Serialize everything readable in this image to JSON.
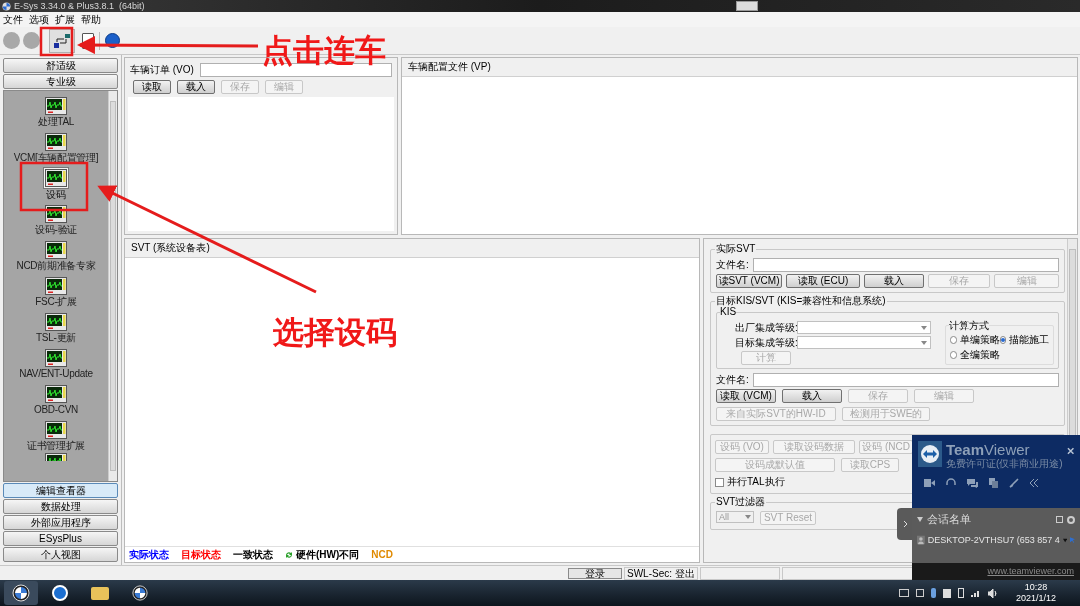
{
  "window": {
    "title": "E-Sys 3.34.0 & Plus3.8.1  (64bit)"
  },
  "menu": [
    "文件",
    "选项",
    "扩展",
    "帮助"
  ],
  "annotations": [
    {
      "text": "点击连车"
    },
    {
      "text": "选择设码"
    }
  ],
  "sidebar": {
    "top_buttons": [
      "舒适级",
      "专业级"
    ],
    "items": [
      {
        "label": "处理TAL",
        "selected": false
      },
      {
        "label": "VCM[车辆配置管理]",
        "selected": false
      },
      {
        "label": "设码",
        "selected": true
      },
      {
        "label": "设码-验证",
        "selected": false
      },
      {
        "label": "NCD前期准备专家",
        "selected": false
      },
      {
        "label": "FSC-扩展",
        "selected": false
      },
      {
        "label": "TSL-更新",
        "selected": false
      },
      {
        "label": "NAV/ENT-Update",
        "selected": false
      },
      {
        "label": "OBD-CVN",
        "selected": false
      },
      {
        "label": "证书管理扩展",
        "selected": false
      }
    ],
    "bottom_buttons": [
      {
        "label": "编辑查看器",
        "selected": true
      },
      {
        "label": "数据处理",
        "selected": false
      },
      {
        "label": "外部应用程序",
        "selected": false
      },
      {
        "label": "ESysPlus",
        "selected": false
      },
      {
        "label": "个人视图",
        "selected": false
      }
    ]
  },
  "vehicle_order": {
    "label": "车辆订单 (VO)",
    "buttons": [
      {
        "label": "读取",
        "disabled": false
      },
      {
        "label": "载入",
        "disabled": false
      },
      {
        "label": "保存",
        "disabled": true
      },
      {
        "label": "编辑",
        "disabled": true
      }
    ]
  },
  "vehicle_profile": {
    "title": "车辆配置文件 (VP)"
  },
  "svt": {
    "title": "SVT (系统设备表)",
    "legend": [
      {
        "kind": "text",
        "label": "实际状态",
        "color": "#0000ff"
      },
      {
        "kind": "text",
        "label": "目标状态",
        "color": "#ff0000"
      },
      {
        "kind": "text",
        "label": "一致状态",
        "color": "#000000"
      },
      {
        "kind": "icon",
        "label": "硬件(HW)不同",
        "color": "#000000"
      },
      {
        "kind": "text",
        "label": "NCD",
        "color": "#e08a00"
      }
    ]
  },
  "actual_svt": {
    "title": "实际SVT",
    "file_label": "文件名:",
    "buttons": [
      {
        "label": "读SVT (VCM)",
        "disabled": false
      },
      {
        "label": "读取 (ECU)",
        "disabled": false
      },
      {
        "label": "载入",
        "disabled": false
      },
      {
        "label": "保存",
        "disabled": true
      },
      {
        "label": "编辑",
        "disabled": true
      }
    ]
  },
  "target": {
    "title": "目标KIS/SVT (KIS=兼容性和信息系统)",
    "kis_title": "KIS",
    "fields": [
      "出厂集成等级:",
      "目标集成等级:"
    ],
    "calc_button": {
      "label": "计算",
      "disabled": true
    },
    "method": {
      "title": "计算方式",
      "options": [
        {
          "label": "单编策略",
          "selected": false
        },
        {
          "label": "描能施工",
          "selected": true
        },
        {
          "label": "全编策略",
          "selected": false
        }
      ]
    },
    "file_label": "文件名:",
    "buttons": [
      {
        "label": "读取 (VCM)",
        "disabled": false
      },
      {
        "label": "载入",
        "disabled": false
      },
      {
        "label": "保存",
        "disabled": true
      },
      {
        "label": "编辑",
        "disabled": true
      }
    ],
    "buttons_2": [
      {
        "label": "来自实际SVT的HW-ID",
        "disabled": true
      },
      {
        "label": "检测用于SWE的",
        "disabled": true
      }
    ]
  },
  "coding": {
    "row_1": [
      {
        "label": "设码 (VO)",
        "disabled": true
      },
      {
        "label": "读取设码数据",
        "disabled": true
      },
      {
        "label": "设码 (NCD",
        "disabled": true
      }
    ],
    "row_2": [
      {
        "label": "设码成默认值",
        "disabled": true
      },
      {
        "label": "读取CPS",
        "disabled": true
      }
    ],
    "parallel": {
      "label": "并行TAL执行",
      "checked": false
    }
  },
  "filter": {
    "title": "SVT过滤器",
    "value": "All",
    "button": {
      "label": "SVT Reset",
      "disabled": true
    }
  },
  "status_bar": {
    "login": "登录",
    "swl": "SWL-Sec: 登出"
  },
  "taskbar": {
    "time": "10:28",
    "date": "2021/1/12"
  },
  "teamviewer": {
    "title": "**Team**Viewer",
    "subtitle": "免费许可证(仅非商业用途)",
    "session_title": "会话名单",
    "session": "DESKTOP-2VTHSU7 (653 857 4",
    "link": "www.teamviewer.com"
  }
}
